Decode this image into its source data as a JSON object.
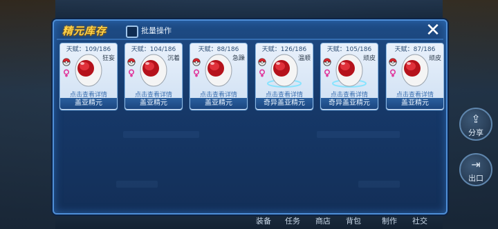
{
  "dialog": {
    "title": "精元库存",
    "batch_label": "批量操作"
  },
  "background": {
    "side_buttons": [
      "分享",
      "出口"
    ],
    "bottom_tabs": [
      "装备",
      "任务",
      "商店",
      "背包",
      "制作",
      "社交"
    ]
  },
  "cards": [
    {
      "talent": "天赋：109/186",
      "trait": "狂妄",
      "detail": "点击查看详情",
      "name": "盖亚精元",
      "special": false
    },
    {
      "talent": "天赋：104/186",
      "trait": "沉着",
      "detail": "点击查看详情",
      "name": "盖亚精元",
      "special": false
    },
    {
      "talent": "天赋：88/186",
      "trait": "急躁",
      "detail": "点击查看详情",
      "name": "盖亚精元",
      "special": false
    },
    {
      "talent": "天赋：126/186",
      "trait": "温顺",
      "detail": "点击查看详情",
      "name": "奇异盖亚精元",
      "special": true
    },
    {
      "talent": "天赋：105/186",
      "trait": "顽皮",
      "detail": "点击查看详情",
      "name": "奇异盖亚精元",
      "special": true
    },
    {
      "talent": "天赋：87/186",
      "trait": "顽皮",
      "detail": "点击查看详情",
      "name": "盖亚精元",
      "special": false
    }
  ]
}
